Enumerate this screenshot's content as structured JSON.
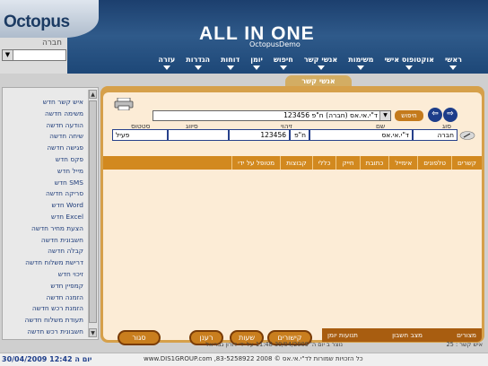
{
  "app": {
    "logo": "Octopus",
    "title": "ALL  IN  ONE",
    "subtitle": "OctopusDemo"
  },
  "company": {
    "label": "חברה",
    "value": ""
  },
  "topnav": [
    "ראשי",
    "אוקטופוס אישי",
    "משימות",
    "אנשי קשר",
    "חיפוש",
    "יומן",
    "דוחות",
    "הגדרות",
    "עזרה"
  ],
  "section_title": "אנשי קשר",
  "sidebar": {
    "items": [
      "איש קשר חדש",
      "משימה חדשה",
      "הודעה חדשה",
      "שיחה חדשה",
      "פגישה חדשה",
      "פקס חדש",
      "מייל חדש",
      "SMS חדש",
      "סריקה חדשה",
      "Word חדש",
      "Excel חדש",
      "הצעת מחיר חדשה",
      "חשבונית חדשה",
      "קבלה חדשה",
      "דרישת משלוח חדשה",
      "זיכוי חדש",
      "קמפיין חדש",
      "הזמנה חדשה",
      "הזמנת רכש חדשה",
      "תעודת משלוח חדשה",
      "חשבונית רכש חדשה"
    ]
  },
  "search": {
    "selected": "ד\"י.אי.אס (חברה) ח\"פ 123456",
    "button": "חיפוש"
  },
  "info": {
    "labels": {
      "type": "סוג",
      "name": "שם",
      "id": "זיהוי",
      "category": "סיווג",
      "status": "סטטוס"
    },
    "values": {
      "type": "חברה",
      "name": "ד\"י.אי.אס",
      "id_type": "ח\"פ",
      "id": "123456",
      "category": "",
      "status": "פעיל"
    }
  },
  "tabs": [
    "קשרים",
    "טלפונים",
    "אימייל",
    "כתובת",
    "חייק",
    "כללי",
    "קבוצות",
    "מטופל על ידי"
  ],
  "bottom_tabs": [
    "מצורים",
    "מצב חשבון",
    "תנועות יומן"
  ],
  "actions": {
    "links": "קישורים",
    "hours": "שעות",
    "refresh": "רענן",
    "close": "סגור"
  },
  "status": {
    "count": "איש קשר : 25",
    "created": "נוצר ב יום ה' 30/04/2009 11:48 על ידי דורון גבריאל"
  },
  "footer": {
    "datetime": "30/04/2009 12:42 יום ה",
    "copyright": "כל הזכויות שמורות לד\"י.אי.אס © 2008 83-5258922, www.DIS1GROUP.com"
  },
  "colors": {
    "header": "#1c3f6e",
    "panel": "#d6a04a",
    "tab": "#d2891f",
    "accent": "#1d3d8a"
  }
}
